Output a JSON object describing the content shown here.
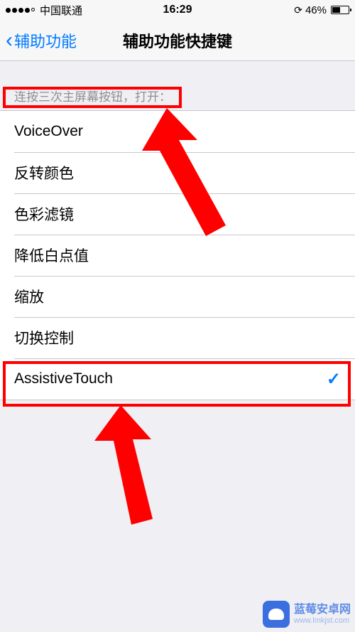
{
  "status": {
    "carrier": "中国联通",
    "time": "16:29",
    "battery_pct": "46%"
  },
  "nav": {
    "back_label": "辅助功能",
    "title": "辅助功能快捷键"
  },
  "section": {
    "header": "连按三次主屏幕按钮，打开："
  },
  "options": [
    {
      "label": "VoiceOver",
      "checked": false
    },
    {
      "label": "反转颜色",
      "checked": false
    },
    {
      "label": "色彩滤镜",
      "checked": false
    },
    {
      "label": "降低白点值",
      "checked": false
    },
    {
      "label": "缩放",
      "checked": false
    },
    {
      "label": "切换控制",
      "checked": false
    },
    {
      "label": "AssistiveTouch",
      "checked": true
    }
  ],
  "watermark": {
    "title": "蓝莓安卓网",
    "url": "www.lmkjst.com"
  }
}
